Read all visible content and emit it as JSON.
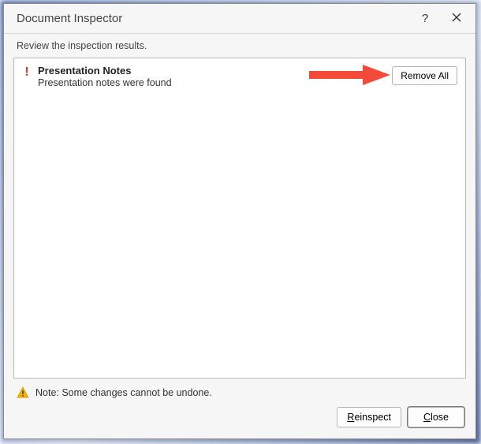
{
  "title": "Document Inspector",
  "instruction": "Review the inspection results.",
  "results": {
    "item": {
      "icon": "exclamation",
      "title": "Presentation Notes",
      "description": "Presentation notes were found",
      "action_label": "Remove All"
    }
  },
  "note": "Note: Some changes cannot be undone.",
  "buttons": {
    "reinspect": "Reinspect",
    "close": "Close"
  },
  "colors": {
    "alert": "#d04020",
    "arrow": "#f44a3a"
  }
}
